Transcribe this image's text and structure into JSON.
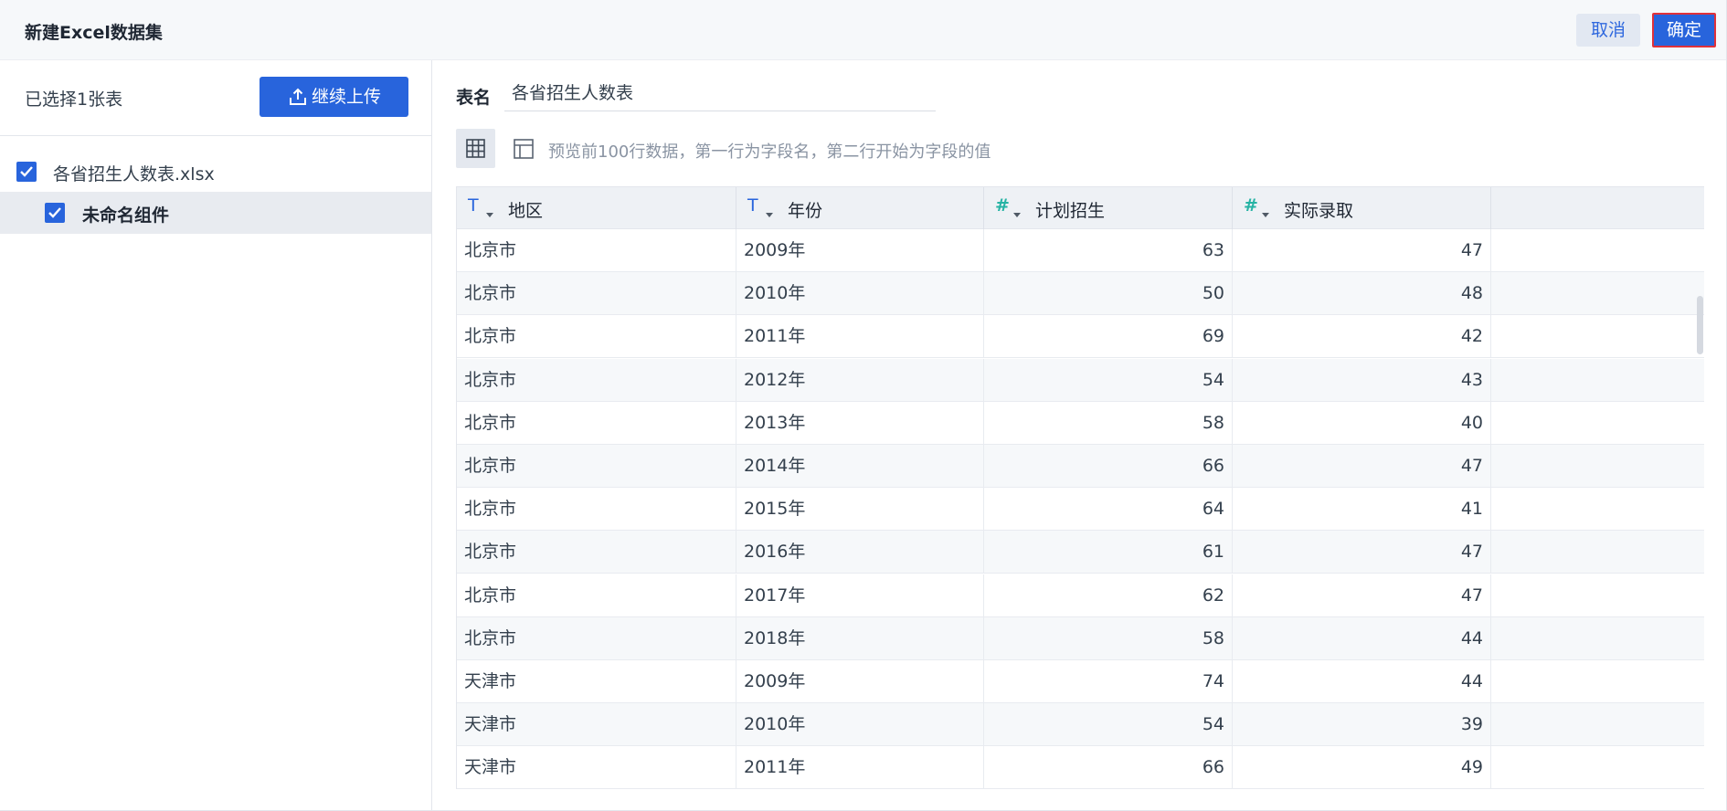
{
  "header": {
    "title": "新建Excel数据集",
    "cancel_label": "取消",
    "confirm_label": "确定"
  },
  "left": {
    "selected_count": "已选择1张表",
    "upload_label": "继续上传",
    "tree": {
      "file_name": "各省招生人数表.xlsx",
      "component_name": "未命名组件"
    }
  },
  "right": {
    "table_name_label": "表名",
    "table_name_value": "各省招生人数表",
    "preview_hint": "预览前100行数据，第一行为字段名，第二行开始为字段的值",
    "columns": [
      {
        "label": "地区",
        "type_icon": "T",
        "type": "text"
      },
      {
        "label": "年份",
        "type_icon": "T",
        "type": "text"
      },
      {
        "label": "计划招生",
        "type_icon": "#",
        "type": "number"
      },
      {
        "label": "实际录取",
        "type_icon": "#",
        "type": "number"
      }
    ],
    "rows": [
      [
        "北京市",
        "2009年",
        "63",
        "47"
      ],
      [
        "北京市",
        "2010年",
        "50",
        "48"
      ],
      [
        "北京市",
        "2011年",
        "69",
        "42"
      ],
      [
        "北京市",
        "2012年",
        "54",
        "43"
      ],
      [
        "北京市",
        "2013年",
        "58",
        "40"
      ],
      [
        "北京市",
        "2014年",
        "66",
        "47"
      ],
      [
        "北京市",
        "2015年",
        "64",
        "41"
      ],
      [
        "北京市",
        "2016年",
        "61",
        "47"
      ],
      [
        "北京市",
        "2017年",
        "62",
        "47"
      ],
      [
        "北京市",
        "2018年",
        "58",
        "44"
      ],
      [
        "天津市",
        "2009年",
        "74",
        "44"
      ],
      [
        "天津市",
        "2010年",
        "54",
        "39"
      ],
      [
        "天津市",
        "2011年",
        "66",
        "49"
      ]
    ]
  },
  "colors": {
    "primary": "#2864dc",
    "confirm_border": "#e0313a",
    "number_type": "#26b3a4"
  }
}
